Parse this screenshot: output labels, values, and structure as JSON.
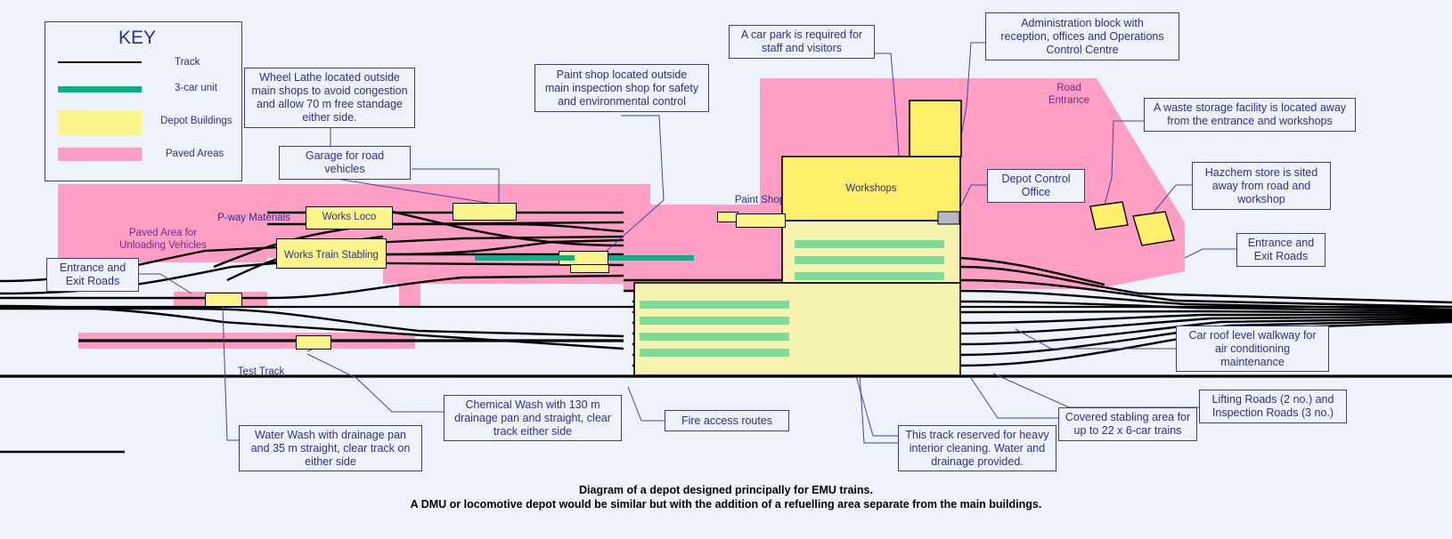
{
  "diagram": {
    "title_line1": "Diagram of a depot designed principally for EMU trains.",
    "title_line2": "A DMU or locomotive depot would be similar but with the addition of a refuelling area separate from the main buildings.",
    "background_color": "#eef3fb",
    "line_color": "#2e2e8c"
  },
  "key": {
    "title": "KEY",
    "items": [
      {
        "label": "Track",
        "type": "line",
        "color": "#000000"
      },
      {
        "label": "3-car unit",
        "type": "bar",
        "color": "#00b387"
      },
      {
        "label": "Depot Buildings",
        "type": "box",
        "color": "#fbf58c"
      },
      {
        "label": "Paved Areas",
        "type": "bar",
        "color": "#ff9ec4"
      }
    ]
  },
  "callouts": [
    {
      "id": "wheel-lathe",
      "text": "Wheel Lathe located outside\nmain shops to avoid congestion\nand allow 70 m free standage\neither side."
    },
    {
      "id": "garage",
      "text": "Garage for road\nvehicles"
    },
    {
      "id": "paint-shop",
      "text": "Paint shop located outside\nmain inspection shop for safety\nand environmental control"
    },
    {
      "id": "car-park",
      "text": "A car park is required for\nstaff and visitors"
    },
    {
      "id": "admin-block",
      "text": "Administration block with\nreception, offices and Operations\nControl Centre"
    },
    {
      "id": "waste-storage",
      "text": "A waste storage facility is located away\nfrom the entrance and workshops"
    },
    {
      "id": "hazchem",
      "text": "Hazchem store is sited\naway from road and\nworkshop"
    },
    {
      "id": "depot-control",
      "text": "Depot Control\nOffice"
    },
    {
      "id": "entrance-exit-right",
      "text": "Entrance and\nExit Roads"
    },
    {
      "id": "entrance-exit-left",
      "text": "Entrance and\nExit Roads"
    },
    {
      "id": "car-roof-walkway",
      "text": "Car roof level walkway for\nair conditioning\nmaintenance"
    },
    {
      "id": "lifting-roads",
      "text": "Lifting Roads (2 no.) and\nInspection Roads (3 no.)"
    },
    {
      "id": "covered-stabling",
      "text": "Covered stabling area for\nup to 22 x 6-car trains"
    },
    {
      "id": "heavy-cleaning",
      "text": "This track reserved for heavy\ninterior cleaning.  Water and\ndrainage provided."
    },
    {
      "id": "fire-access",
      "text": "Fire access routes"
    },
    {
      "id": "chemical-wash",
      "text": "Chemical Wash with 130 m\ndrainage pan and straight, clear\ntrack either side"
    },
    {
      "id": "water-wash",
      "text": "Water Wash with drainage pan\nand 35 m straight, clear track on\neither side"
    }
  ],
  "map_labels": [
    {
      "id": "paved-unloading",
      "text": "Paved Area for\nUnloading Vehicles"
    },
    {
      "id": "pway-materials",
      "text": "P-way Materials"
    },
    {
      "id": "works-loco",
      "text": "Works Loco"
    },
    {
      "id": "works-train-stabling",
      "text": "Works Train Stabling"
    },
    {
      "id": "paint-shop-label",
      "text": "Paint Shop"
    },
    {
      "id": "workshops",
      "text": "Workshops"
    },
    {
      "id": "road-entrance",
      "text": "Road\nEntrance"
    },
    {
      "id": "test-track",
      "text": "Test Track"
    }
  ],
  "colors": {
    "paved": "#ff9ec4",
    "building": "#ffef6b",
    "building_pale": "#f7f3b0",
    "unit_green": "#00b387",
    "stabled_unit": "#7ddc9a",
    "track": "#000000",
    "leader": "#4343a0"
  }
}
